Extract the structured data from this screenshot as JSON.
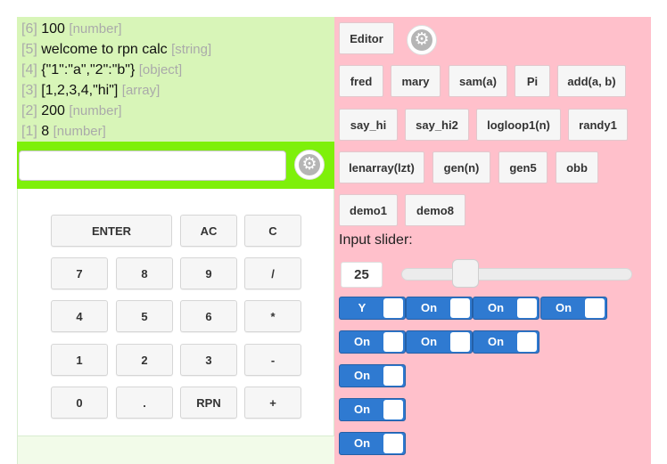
{
  "stack": [
    {
      "index": "[6]",
      "value": "100",
      "type": "[number]"
    },
    {
      "index": "[5]",
      "value": "welcome to rpn calc",
      "type": "[string]"
    },
    {
      "index": "[4]",
      "value": "{\"1\":\"a\",\"2\":\"b\"}",
      "type": "[object]"
    },
    {
      "index": "[3]",
      "value": "[1,2,3,4,\"hi\"]",
      "type": "[array]"
    },
    {
      "index": "[2]",
      "value": "200",
      "type": "[number]"
    },
    {
      "index": "[1]",
      "value": "8",
      "type": "[number]"
    }
  ],
  "entry": {
    "value": "",
    "placeholder": ""
  },
  "keypad": {
    "enter": "ENTER",
    "ac": "AC",
    "c": "C",
    "k7": "7",
    "k8": "8",
    "k9": "9",
    "div": "/",
    "k4": "4",
    "k5": "5",
    "k6": "6",
    "mul": "*",
    "k1": "1",
    "k2": "2",
    "k3": "3",
    "sub": "-",
    "k0": "0",
    "dot": ".",
    "rpn": "RPN",
    "add": "+"
  },
  "editor_button": "Editor",
  "functions": [
    "fred",
    "mary",
    "sam(a)",
    "Pi",
    "add(a, b)",
    "say_hi",
    "say_hi2",
    "logloop1(n)",
    "randy1",
    "lenarray(lzt)",
    "gen(n)",
    "gen5",
    "obb",
    "demo1",
    "demo8"
  ],
  "slider": {
    "label": "Input slider:",
    "value": "25"
  },
  "toggles": [
    "Y",
    "On",
    "On",
    "On",
    "On",
    "On",
    "On",
    "On",
    "On",
    "On"
  ],
  "colors": {
    "stack_bg": "#d8f5b8",
    "entry_bar": "#7ef00a",
    "right_panel": "#ffc0cb",
    "toggle_on": "#2f7ad1"
  }
}
